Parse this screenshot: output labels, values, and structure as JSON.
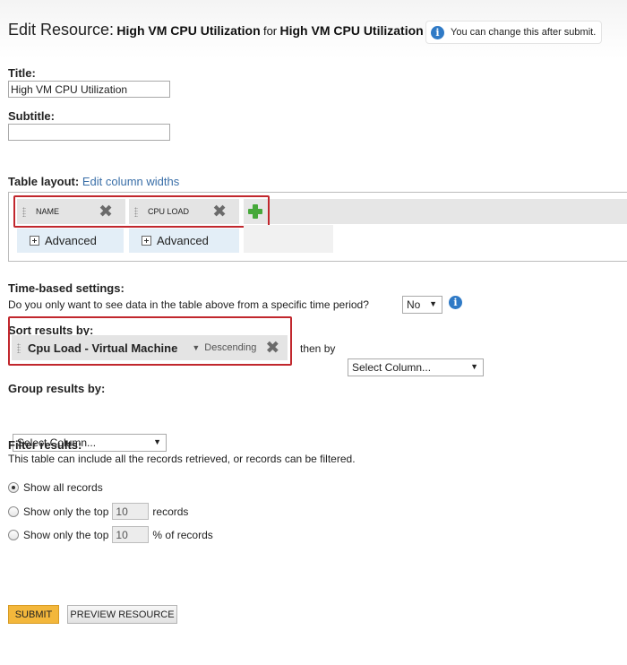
{
  "header": {
    "prefix": "Edit Resource:",
    "resource_name": "High VM CPU Utilization",
    "connector": "for",
    "resource_for": "High VM CPU Utilization",
    "hint": "You can change this after submit."
  },
  "title_field": {
    "label": "Title:",
    "value": "High VM CPU Utilization"
  },
  "subtitle_field": {
    "label": "Subtitle:",
    "value": ""
  },
  "table_layout": {
    "label": "Table layout:",
    "edit_link": "Edit column widths",
    "columns": [
      {
        "name": "NAME",
        "advanced": "Advanced"
      },
      {
        "name": "CPU LOAD",
        "advanced": "Advanced"
      }
    ]
  },
  "time_settings": {
    "label": "Time-based settings:",
    "question": "Do you only want to see data in the table above from a specific time period?",
    "selected": "No"
  },
  "sort": {
    "label": "Sort results by:",
    "column": "Cpu Load - Virtual Machine",
    "direction": "Descending",
    "then_by": "then by",
    "then_select": "Select Column..."
  },
  "group": {
    "label": "Group results by:",
    "select": "Select Column..."
  },
  "filter": {
    "label": "Filter results:",
    "description": "This table can include all the records retrieved, or records can be filtered.",
    "options": [
      {
        "label": "Show all records",
        "checked": true
      },
      {
        "label": "Show only the top",
        "value": "10",
        "suffix": "records",
        "checked": false
      },
      {
        "label": "Show only the top",
        "value": "10",
        "suffix": "% of records",
        "checked": false
      }
    ]
  },
  "buttons": {
    "submit": "SUBMIT",
    "preview": "PREVIEW RESOURCE"
  },
  "colors": {
    "highlight": "#c1272d",
    "submit_bg": "#f3b73b",
    "link": "#3a6fa8",
    "info": "#2f7ac6"
  }
}
